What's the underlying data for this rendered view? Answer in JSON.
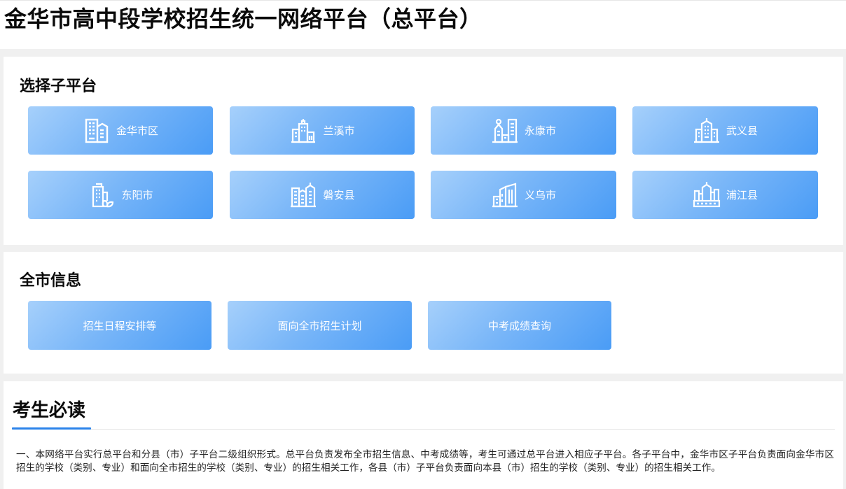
{
  "page": {
    "title": "金华市高中段学校招生统一网络平台（总平台）"
  },
  "sub_platforms": {
    "title": "选择子平台",
    "items": [
      {
        "label": "金华市区",
        "icon": "office-building-icon"
      },
      {
        "label": "兰溪市",
        "icon": "tower-building-icon"
      },
      {
        "label": "永康市",
        "icon": "clock-tower-building-icon"
      },
      {
        "label": "武义县",
        "icon": "highrise-building-icon"
      },
      {
        "label": "东阳市",
        "icon": "eco-building-icon"
      },
      {
        "label": "磐安县",
        "icon": "apartment-buildings-icon"
      },
      {
        "label": "义乌市",
        "icon": "modern-building-icon"
      },
      {
        "label": "浦江县",
        "icon": "city-skyline-icon"
      }
    ]
  },
  "city_info": {
    "title": "全市信息",
    "items": [
      {
        "label": "招生日程安排等"
      },
      {
        "label": "面向全市招生计划"
      },
      {
        "label": "中考成绩查询"
      }
    ]
  },
  "must_read": {
    "title": "考生必读",
    "paragraphs": [
      "一、本网络平台实行总平台和分县（市）子平台二级组织形式。总平台负责发布全市招生信息、中考成绩等，考生可通过总平台进入相应子平台。各子平台中，金华市区子平台负责面向金华市区招生的学校（类别、专业）和面向全市招生的学校（类别、专业）的招生相关工作，各县（市）子平台负责面向本县（市）招生的学校（类别、专业）的招生相关工作。"
    ]
  },
  "colors": {
    "tile_gradient_start": "#a6d0fb",
    "tile_gradient_end": "#4a9cf6",
    "accent_underline": "#2b83ea",
    "page_background": "#f0f0f0"
  }
}
